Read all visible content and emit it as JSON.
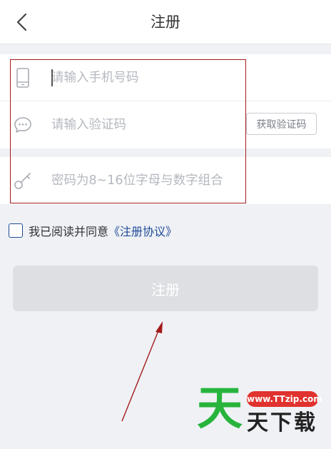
{
  "header": {
    "title": "注册",
    "back_icon": "chevron-left-icon"
  },
  "form": {
    "phone": {
      "placeholder": "请输入手机号码",
      "icon": "phone-icon"
    },
    "code": {
      "placeholder": "请输入验证码",
      "icon": "chat-bubble-icon",
      "button_label": "获取验证码"
    },
    "password": {
      "placeholder": "密码为8~16位字母与数字组合",
      "icon": "key-icon"
    }
  },
  "agreement": {
    "text": "我已阅读并同意",
    "link": "《注册协议》",
    "checked": false
  },
  "submit": {
    "label": "注册",
    "enabled": false
  },
  "watermark": {
    "big": "天",
    "url": "www.TTzip.com",
    "small": "天下载"
  },
  "colors": {
    "page_bg": "#eff1f5",
    "accent_blue": "#1f4a96",
    "annotation_red": "#a31b1b",
    "disabled_button": "#dedfe2",
    "watermark_green": "#27b43c",
    "watermark_red": "#e0322e"
  }
}
